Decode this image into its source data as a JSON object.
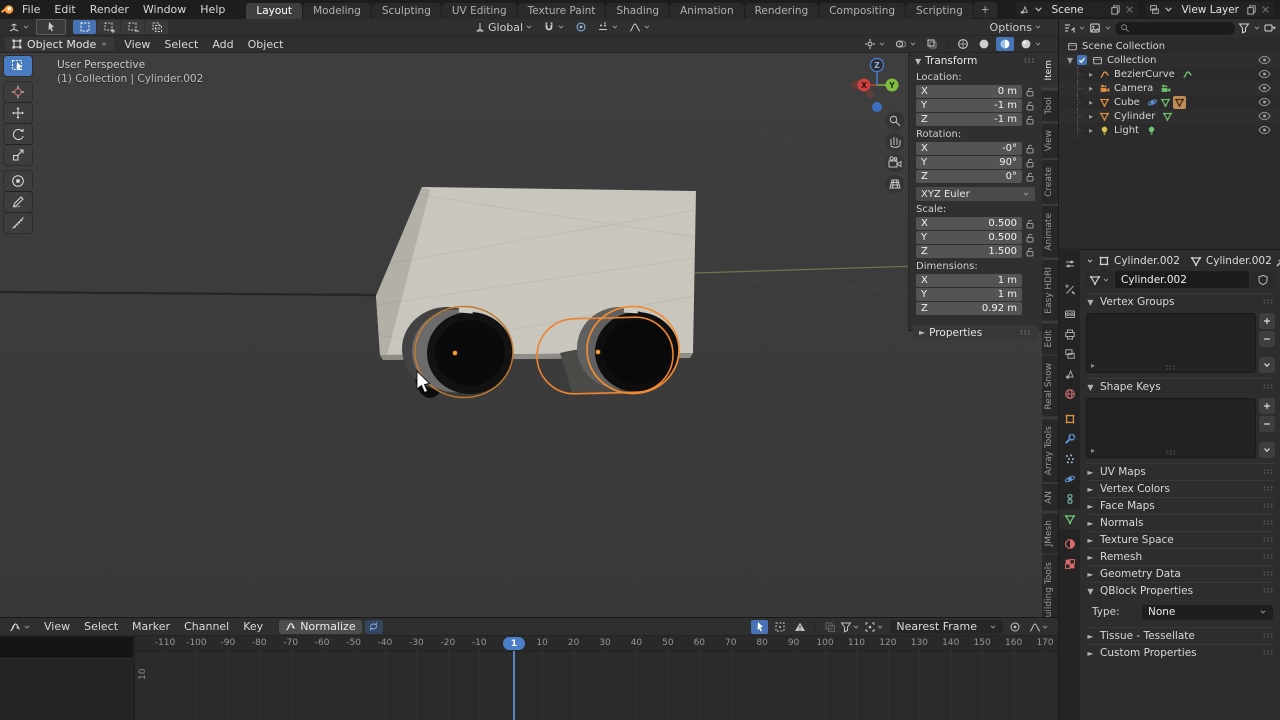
{
  "topbar": {
    "menus": [
      "File",
      "Edit",
      "Render",
      "Window",
      "Help"
    ],
    "workspaces": [
      "Layout",
      "Modeling",
      "Sculpting",
      "UV Editing",
      "Texture Paint",
      "Shading",
      "Animation",
      "Rendering",
      "Compositing",
      "Scripting"
    ],
    "active_workspace": "Layout",
    "new_workspace_label": "+",
    "scene_selector": {
      "value": "Scene"
    },
    "view_layer_selector": {
      "value": "View Layer"
    }
  },
  "viewport": {
    "mode": "Object Mode",
    "menus": [
      "View",
      "Select",
      "Add",
      "Object"
    ],
    "orientation": "Global",
    "options_label": "Options",
    "overlay_line1": "User Perspective",
    "overlay_line2": "(1) Collection | Cylinder.002",
    "tools": [
      "select-box",
      "cursor",
      "move",
      "rotate",
      "scale",
      "transform",
      "annotate",
      "measure"
    ],
    "active_tool": "select-box",
    "gizmo_axes": {
      "x": "X",
      "y": "Y",
      "z": "Z"
    }
  },
  "npanel": {
    "tabs": [
      "Item",
      "Tool",
      "View",
      "Create",
      "Animate",
      "Easy HDRI",
      "Edit",
      "Real Snow",
      "Array Tools",
      "AN",
      "JMesh",
      "Building Tools"
    ],
    "active_tab": "Item",
    "transform_title": "Transform",
    "location_label": "Location:",
    "location": {
      "x": "0 m",
      "y": "-1 m",
      "z": "-1 m"
    },
    "rotation_label": "Rotation:",
    "rotation": {
      "x": "-0°",
      "y": "90°",
      "z": "0°"
    },
    "rotation_mode": "XYZ Euler",
    "scale_label": "Scale:",
    "scale": {
      "x": "0.500",
      "y": "0.500",
      "z": "1.500"
    },
    "dimensions_label": "Dimensions:",
    "dimensions": {
      "x": "1 m",
      "y": "1 m",
      "z": "0.92 m"
    },
    "axis_x": "X",
    "axis_y": "Y",
    "axis_z": "Z",
    "properties_title": "Properties"
  },
  "outliner": {
    "root_label": "Scene Collection",
    "collection_label": "Collection",
    "items": [
      {
        "label": "BezierCurve",
        "icon": "curve",
        "icon_color": "i-orange",
        "badges": [
          "curve-data"
        ]
      },
      {
        "label": "Camera",
        "icon": "camera",
        "icon_color": "i-orange",
        "badges": [
          "camera-data"
        ]
      },
      {
        "label": "Cube",
        "icon": "mesh",
        "icon_color": "i-orange",
        "badges": [
          "physics",
          "mesh-data",
          "mesh-active"
        ]
      },
      {
        "label": "Cylinder",
        "icon": "mesh",
        "icon_color": "i-orange",
        "badges": [
          "mesh-data"
        ]
      },
      {
        "label": "Light",
        "icon": "light",
        "icon_color": "i-yellow",
        "badges": [
          "light-data"
        ]
      }
    ]
  },
  "properties": {
    "breadcrumb_object": "Cylinder.002",
    "breadcrumb_data": "Cylinder.002",
    "name_value": "Cylinder.002",
    "tabs": [
      {
        "name": "editor-type",
        "icon": "sliders",
        "color": "#b5b5b5"
      },
      {
        "name": "tool",
        "icon": "tool",
        "color": "#a8a8a8",
        "gap": true
      },
      {
        "name": "render",
        "icon": "camera-back",
        "color": "#a8a8a8",
        "gap": true
      },
      {
        "name": "output",
        "icon": "printer",
        "color": "#a8a8a8"
      },
      {
        "name": "view-layer",
        "icon": "layers",
        "color": "#a8a8a8"
      },
      {
        "name": "scene",
        "icon": "scene",
        "color": "#a8a8a8"
      },
      {
        "name": "world",
        "icon": "world",
        "color": "#c96d6d"
      },
      {
        "name": "object",
        "icon": "object",
        "color": "#e0913f",
        "gap": true
      },
      {
        "name": "modifiers",
        "icon": "wrench",
        "color": "#5e93d1"
      },
      {
        "name": "particles",
        "icon": "particles",
        "color": "#9fb7cf"
      },
      {
        "name": "physics",
        "icon": "physics",
        "color": "#5e93d1"
      },
      {
        "name": "constraints",
        "icon": "constraint",
        "color": "#86c7c0"
      },
      {
        "name": "object-data",
        "icon": "data-tri",
        "color": "#6fc36f",
        "active": true
      },
      {
        "name": "material",
        "icon": "material",
        "color": "#d96a6a",
        "gap": true
      },
      {
        "name": "texture",
        "icon": "texture",
        "color": "#d96a6a"
      }
    ],
    "panels": {
      "vertex_groups": "Vertex Groups",
      "shape_keys": "Shape Keys",
      "collapsed": [
        "UV Maps",
        "Vertex Colors",
        "Face Maps",
        "Normals",
        "Texture Space",
        "Remesh",
        "Geometry Data"
      ],
      "qblock_title": "QBlock Properties",
      "type_label": "Type:",
      "type_value": "None",
      "collapsed2": [
        "Tissue - Tessellate",
        "Custom Properties"
      ]
    }
  },
  "graph": {
    "menus": [
      "View",
      "Select",
      "Marker",
      "Channel",
      "Key"
    ],
    "normalize_label": "Normalize",
    "frame_snap": "Nearest Frame",
    "current_frame": "1",
    "y_axis_value": "10",
    "ticks": [
      -110,
      -100,
      -90,
      -80,
      -70,
      -60,
      -50,
      -40,
      -30,
      -20,
      -10,
      10,
      20,
      30,
      40,
      50,
      60,
      70,
      80,
      90,
      100,
      110,
      120,
      130,
      140,
      150,
      160,
      170
    ]
  },
  "colors": {
    "accent_blue": "#4772b3",
    "selection_orange": "#c07a2f",
    "active_orange": "#f08c33",
    "frame_badge": "#4b80c8",
    "body_gray": "#c9c6bd"
  }
}
